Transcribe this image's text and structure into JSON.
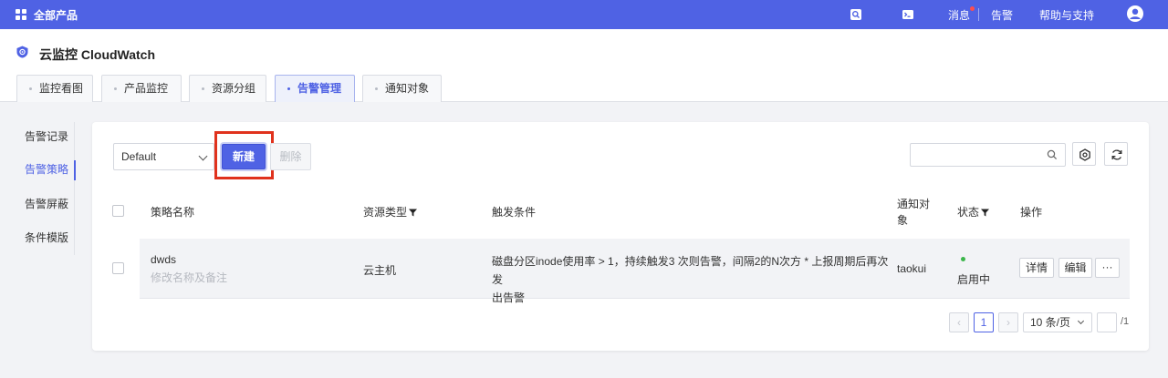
{
  "topbar": {
    "all_products": "全部产品",
    "messages": "消息",
    "alerts": "告警",
    "help": "帮助与支持"
  },
  "header": {
    "app_title": "云监控 CloudWatch",
    "tabs": [
      {
        "label": "监控看图",
        "active": false
      },
      {
        "label": "产品监控",
        "active": false
      },
      {
        "label": "资源分组",
        "active": false
      },
      {
        "label": "告警管理",
        "active": true
      },
      {
        "label": "通知对象",
        "active": false
      }
    ]
  },
  "sidebar": {
    "items": [
      {
        "label": "告警记录",
        "active": false
      },
      {
        "label": "告警策略",
        "active": true
      },
      {
        "label": "告警屏蔽",
        "active": false
      },
      {
        "label": "条件模版",
        "active": false
      }
    ]
  },
  "toolbar": {
    "group_select": "Default",
    "new_label": "新建",
    "delete_label": "删除",
    "search_placeholder": ""
  },
  "table": {
    "columns": {
      "name": "策略名称",
      "resource_type": "资源类型",
      "trigger": "触发条件",
      "notify_line1": "通知对",
      "notify_line2": "象",
      "status": "状态",
      "actions": "操作"
    },
    "rows": [
      {
        "name": "dwds",
        "remark": "修改名称及备注",
        "resource_type": "云主机",
        "trigger_line1": "磁盘分区inode使用率 > 1，持续触发3 次则告警，间隔2的N次方 * 上报周期后再次发",
        "trigger_line2": "出告警",
        "notify": "taokui",
        "status": "启用中",
        "actions": {
          "detail": "详情",
          "edit": "编辑",
          "more": "···"
        }
      }
    ]
  },
  "pagination": {
    "prev": "‹",
    "current": "1",
    "next": "›",
    "page_size": "10 条/页",
    "total": "/1"
  },
  "colors": {
    "brand": "#4f62e4",
    "highlight": "#e0321d",
    "status_ok": "#3cb64b"
  }
}
